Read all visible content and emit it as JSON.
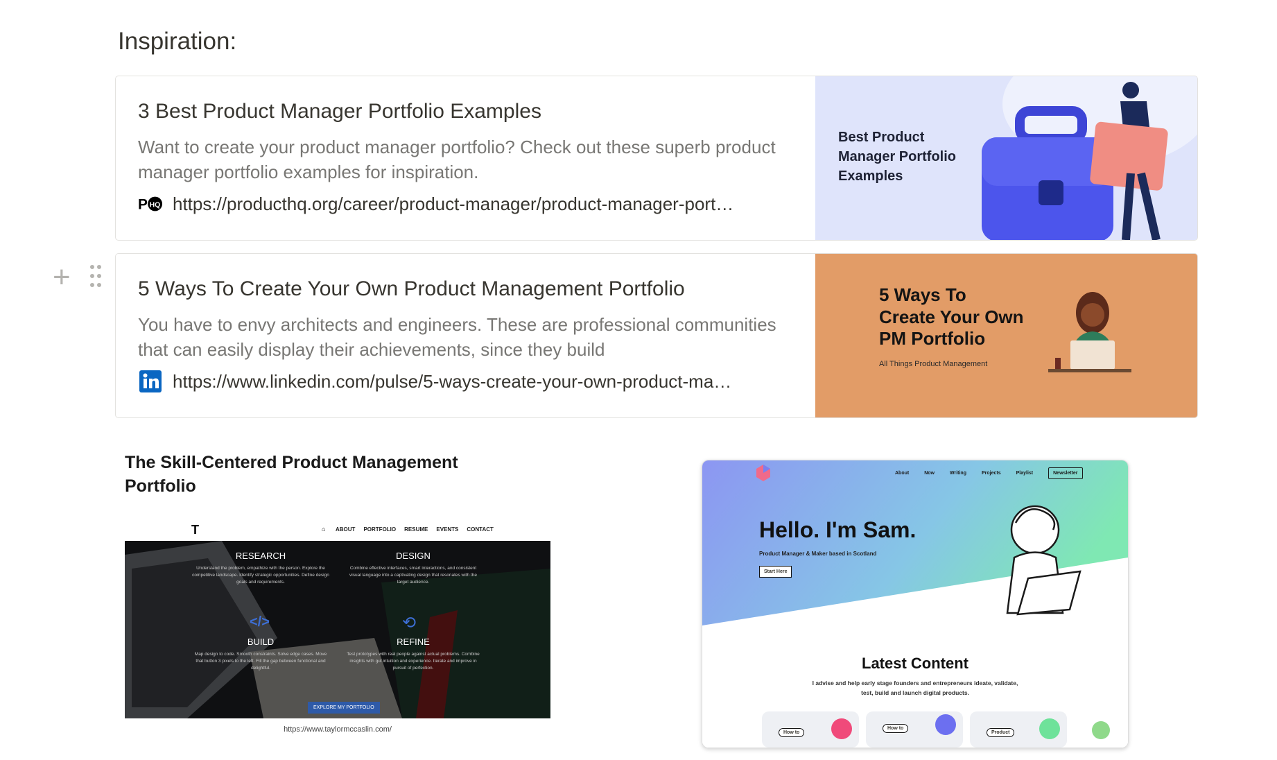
{
  "heading": "Inspiration:",
  "bookmarks": [
    {
      "title": "3 Best Product Manager Portfolio Examples",
      "description": "Want to create your product manager portfolio? Check out these superb product manager portfolio examples for inspiration.",
      "url": "https://producthq.org/career/product-manager/product-manager-port…",
      "favicon": "producthq-logo-icon",
      "thumb_text": "Best Product Manager Portfolio Examples",
      "thumb_bg": "#dfe4fb"
    },
    {
      "title": "5 Ways To Create Your Own Product Management Portfolio",
      "description": "You have to envy architects and engineers. These are professional communities that can easily display their achievements, since they build",
      "url": "https://www.linkedin.com/pulse/5-ways-create-your-own-product-ma…",
      "favicon": "linkedin-icon",
      "thumb_title": "5 Ways To Create Your Own PM Portfolio",
      "thumb_sub": "All Things Product Management",
      "thumb_bg": "#e29c67"
    }
  ],
  "image1": {
    "caption_title": "The Skill-Centered Product Management Portfolio",
    "nav": [
      "ABOUT",
      "PORTFOLIO",
      "RESUME",
      "EVENTS",
      "CONTACT"
    ],
    "sections": [
      {
        "label": "RESEARCH",
        "text": "Understand the problem, empathize with the person. Explore the competitive landscape. Identify strategic opportunities. Define design goals and requirements."
      },
      {
        "label": "DESIGN",
        "text": "Combine effective interfaces, smart interactions, and consistent visual language into a captivating design that resonates with the target audience."
      },
      {
        "label": "BUILD",
        "text": "Map design to code. Smooth constraints. Solve edge cases. Move that button 3 pixels to the left. Fill the gap between functional and delightful."
      },
      {
        "label": "REFINE",
        "text": "Test prototypes with real people against actual problems. Combine insights with gut intuition and experience. Iterate and improve in pursuit of perfection."
      }
    ],
    "button": "EXPLORE MY PORTFOLIO",
    "url": "https://www.taylormccaslin.com/"
  },
  "image2": {
    "nav": [
      "About",
      "Now",
      "Writing",
      "Projects",
      "Playlist",
      "Newsletter"
    ],
    "hero": "Hello. I'm Sam.",
    "sub": "Product Manager & Maker based in Scotland",
    "cta": "Start Here",
    "section_title": "Latest Content",
    "section_text": "I advise and help early stage founders and entrepreneurs ideate, validate, test, build and launch digital products.",
    "cards": [
      "How to",
      "How to",
      "Product"
    ]
  }
}
